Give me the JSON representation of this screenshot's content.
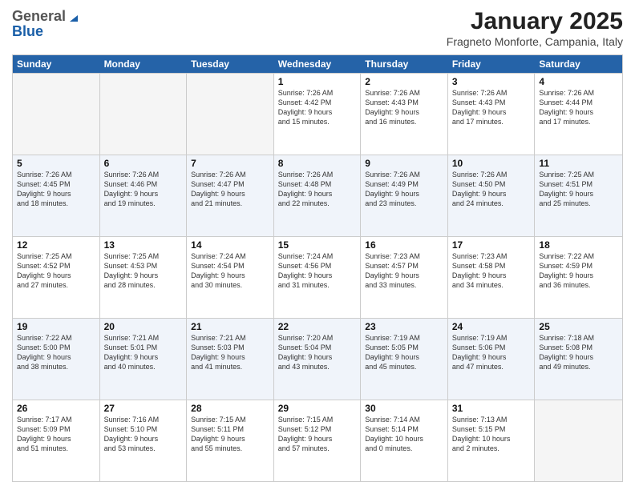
{
  "header": {
    "logo_general": "General",
    "logo_blue": "Blue",
    "month_title": "January 2025",
    "location": "Fragneto Monforte, Campania, Italy"
  },
  "weekdays": [
    "Sunday",
    "Monday",
    "Tuesday",
    "Wednesday",
    "Thursday",
    "Friday",
    "Saturday"
  ],
  "rows": [
    {
      "alt": false,
      "cells": [
        {
          "day": "",
          "info": ""
        },
        {
          "day": "",
          "info": ""
        },
        {
          "day": "",
          "info": ""
        },
        {
          "day": "1",
          "info": "Sunrise: 7:26 AM\nSunset: 4:42 PM\nDaylight: 9 hours\nand 15 minutes."
        },
        {
          "day": "2",
          "info": "Sunrise: 7:26 AM\nSunset: 4:43 PM\nDaylight: 9 hours\nand 16 minutes."
        },
        {
          "day": "3",
          "info": "Sunrise: 7:26 AM\nSunset: 4:43 PM\nDaylight: 9 hours\nand 17 minutes."
        },
        {
          "day": "4",
          "info": "Sunrise: 7:26 AM\nSunset: 4:44 PM\nDaylight: 9 hours\nand 17 minutes."
        }
      ]
    },
    {
      "alt": true,
      "cells": [
        {
          "day": "5",
          "info": "Sunrise: 7:26 AM\nSunset: 4:45 PM\nDaylight: 9 hours\nand 18 minutes."
        },
        {
          "day": "6",
          "info": "Sunrise: 7:26 AM\nSunset: 4:46 PM\nDaylight: 9 hours\nand 19 minutes."
        },
        {
          "day": "7",
          "info": "Sunrise: 7:26 AM\nSunset: 4:47 PM\nDaylight: 9 hours\nand 21 minutes."
        },
        {
          "day": "8",
          "info": "Sunrise: 7:26 AM\nSunset: 4:48 PM\nDaylight: 9 hours\nand 22 minutes."
        },
        {
          "day": "9",
          "info": "Sunrise: 7:26 AM\nSunset: 4:49 PM\nDaylight: 9 hours\nand 23 minutes."
        },
        {
          "day": "10",
          "info": "Sunrise: 7:26 AM\nSunset: 4:50 PM\nDaylight: 9 hours\nand 24 minutes."
        },
        {
          "day": "11",
          "info": "Sunrise: 7:25 AM\nSunset: 4:51 PM\nDaylight: 9 hours\nand 25 minutes."
        }
      ]
    },
    {
      "alt": false,
      "cells": [
        {
          "day": "12",
          "info": "Sunrise: 7:25 AM\nSunset: 4:52 PM\nDaylight: 9 hours\nand 27 minutes."
        },
        {
          "day": "13",
          "info": "Sunrise: 7:25 AM\nSunset: 4:53 PM\nDaylight: 9 hours\nand 28 minutes."
        },
        {
          "day": "14",
          "info": "Sunrise: 7:24 AM\nSunset: 4:54 PM\nDaylight: 9 hours\nand 30 minutes."
        },
        {
          "day": "15",
          "info": "Sunrise: 7:24 AM\nSunset: 4:56 PM\nDaylight: 9 hours\nand 31 minutes."
        },
        {
          "day": "16",
          "info": "Sunrise: 7:23 AM\nSunset: 4:57 PM\nDaylight: 9 hours\nand 33 minutes."
        },
        {
          "day": "17",
          "info": "Sunrise: 7:23 AM\nSunset: 4:58 PM\nDaylight: 9 hours\nand 34 minutes."
        },
        {
          "day": "18",
          "info": "Sunrise: 7:22 AM\nSunset: 4:59 PM\nDaylight: 9 hours\nand 36 minutes."
        }
      ]
    },
    {
      "alt": true,
      "cells": [
        {
          "day": "19",
          "info": "Sunrise: 7:22 AM\nSunset: 5:00 PM\nDaylight: 9 hours\nand 38 minutes."
        },
        {
          "day": "20",
          "info": "Sunrise: 7:21 AM\nSunset: 5:01 PM\nDaylight: 9 hours\nand 40 minutes."
        },
        {
          "day": "21",
          "info": "Sunrise: 7:21 AM\nSunset: 5:03 PM\nDaylight: 9 hours\nand 41 minutes."
        },
        {
          "day": "22",
          "info": "Sunrise: 7:20 AM\nSunset: 5:04 PM\nDaylight: 9 hours\nand 43 minutes."
        },
        {
          "day": "23",
          "info": "Sunrise: 7:19 AM\nSunset: 5:05 PM\nDaylight: 9 hours\nand 45 minutes."
        },
        {
          "day": "24",
          "info": "Sunrise: 7:19 AM\nSunset: 5:06 PM\nDaylight: 9 hours\nand 47 minutes."
        },
        {
          "day": "25",
          "info": "Sunrise: 7:18 AM\nSunset: 5:08 PM\nDaylight: 9 hours\nand 49 minutes."
        }
      ]
    },
    {
      "alt": false,
      "cells": [
        {
          "day": "26",
          "info": "Sunrise: 7:17 AM\nSunset: 5:09 PM\nDaylight: 9 hours\nand 51 minutes."
        },
        {
          "day": "27",
          "info": "Sunrise: 7:16 AM\nSunset: 5:10 PM\nDaylight: 9 hours\nand 53 minutes."
        },
        {
          "day": "28",
          "info": "Sunrise: 7:15 AM\nSunset: 5:11 PM\nDaylight: 9 hours\nand 55 minutes."
        },
        {
          "day": "29",
          "info": "Sunrise: 7:15 AM\nSunset: 5:12 PM\nDaylight: 9 hours\nand 57 minutes."
        },
        {
          "day": "30",
          "info": "Sunrise: 7:14 AM\nSunset: 5:14 PM\nDaylight: 10 hours\nand 0 minutes."
        },
        {
          "day": "31",
          "info": "Sunrise: 7:13 AM\nSunset: 5:15 PM\nDaylight: 10 hours\nand 2 minutes."
        },
        {
          "day": "",
          "info": ""
        }
      ]
    }
  ]
}
